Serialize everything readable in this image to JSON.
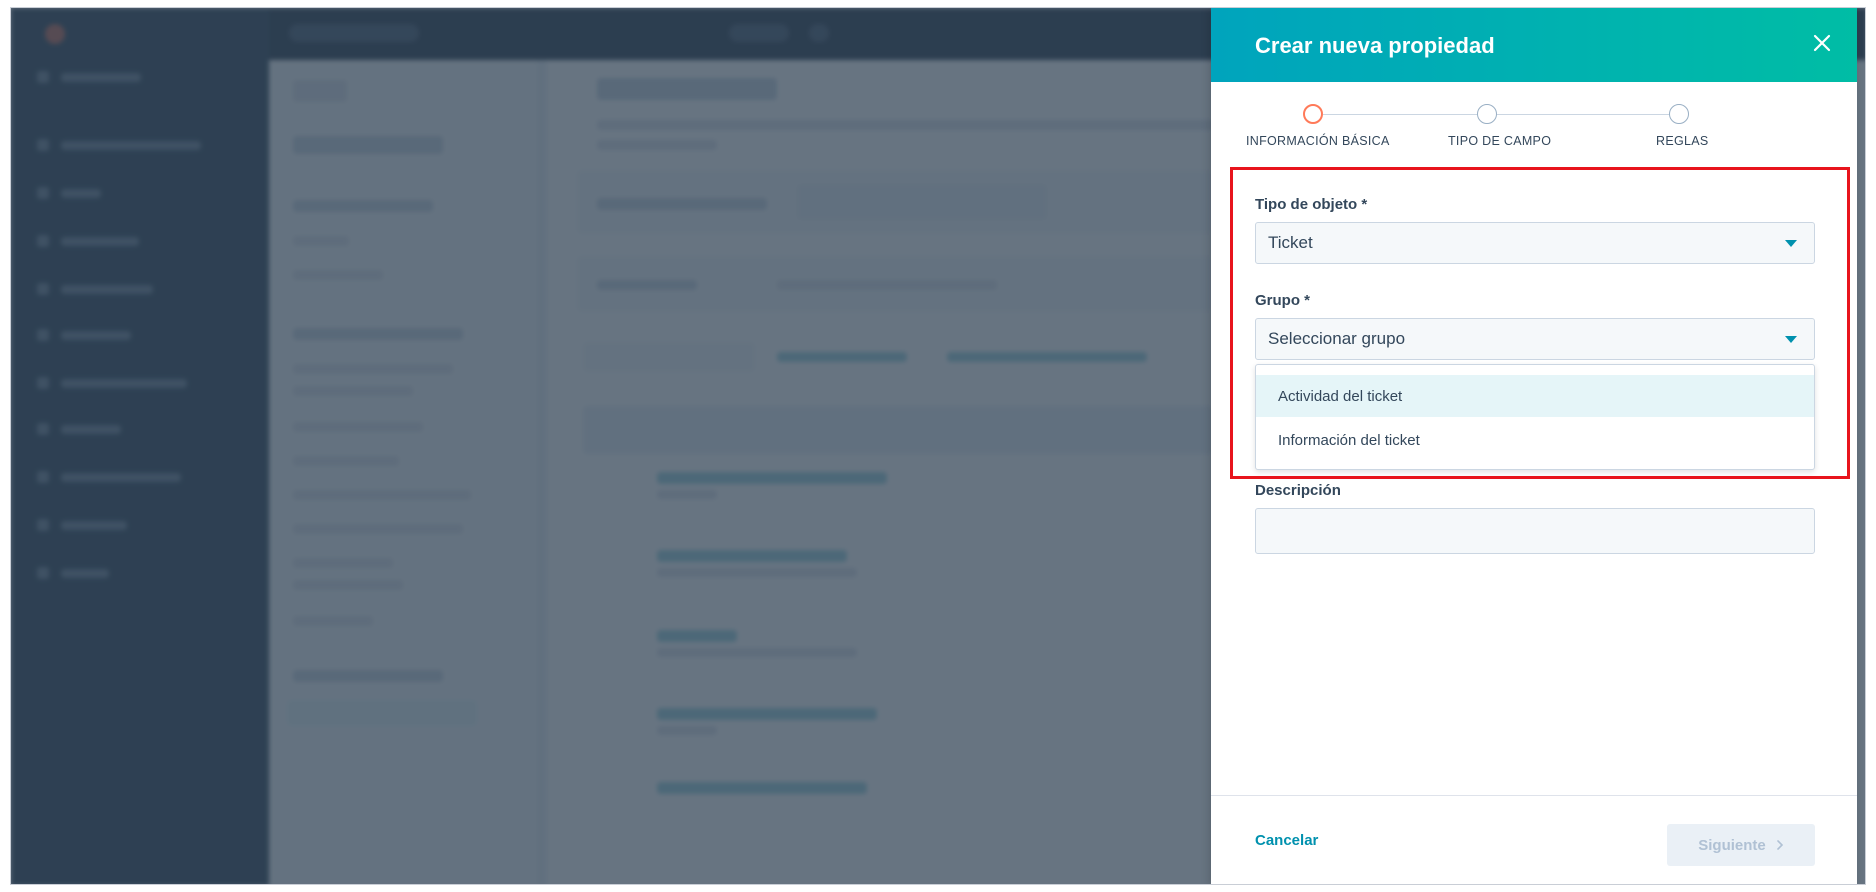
{
  "modal": {
    "title": "Crear nueva propiedad",
    "steps": [
      {
        "label": "INFORMACIÓN BÁSICA",
        "state": "active"
      },
      {
        "label": "TIPO DE CAMPO",
        "state": "pending"
      },
      {
        "label": "REGLAS",
        "state": "pending"
      }
    ],
    "object_type": {
      "label": "Tipo de objeto *",
      "value": "Ticket"
    },
    "group": {
      "label": "Grupo *",
      "placeholder": "Seleccionar grupo",
      "options": [
        "Actividad del ticket",
        "Información del ticket"
      ]
    },
    "description": {
      "label": "Descripción",
      "value": ""
    },
    "footer": {
      "cancel_label": "Cancelar",
      "next_label": "Siguiente"
    }
  },
  "icons": {
    "close": "close-icon",
    "caret": "caret-down-icon",
    "next": "chevron-right-icon"
  },
  "colors": {
    "header_start": "#00a4bd",
    "header_end": "#00bda5",
    "accent": "#0091ae",
    "active_step": "#ff7a59",
    "highlight": "#e8141c"
  }
}
